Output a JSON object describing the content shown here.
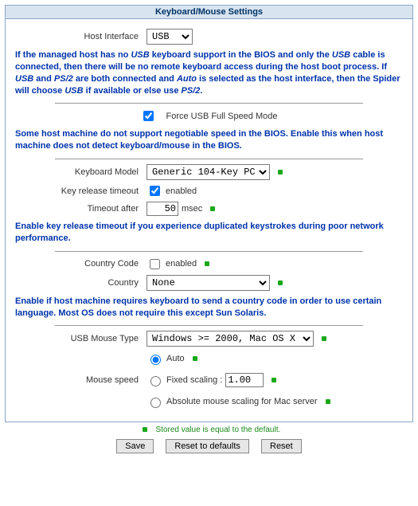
{
  "title": "Keyboard/Mouse Settings",
  "host_interface": {
    "label": "Host Interface",
    "value": "USB",
    "options": [
      "USB"
    ]
  },
  "help_host": "If the managed host has no <i>USB</i> keyboard support in the BIOS and only the <i>USB</i> cable is connected, then there will be no remote keyboard access during the host boot process. If <i>USB</i> and <i>PS/2</i> are both connected and <i>Auto</i> is selected as the host interface, then the Spider will choose <i>USB</i> if available or else use <i>PS/2</i>.",
  "force_usb": {
    "label": "Force USB Full Speed Mode",
    "checked": true
  },
  "help_usb_speed": "Some host machine do not support negotiable speed in the BIOS. Enable this when host machine does not detect keyboard/mouse in the BIOS.",
  "keyboard_model": {
    "label": "Keyboard Model",
    "value": "Generic 104-Key PC",
    "options": [
      "Generic 104-Key PC"
    ]
  },
  "key_release": {
    "label": "Key release timeout",
    "enabled_label": "enabled",
    "checked": true
  },
  "timeout": {
    "label": "Timeout after",
    "value": "50",
    "unit": "msec"
  },
  "help_release": "Enable key release timeout if you experience duplicated keystrokes during poor network performance.",
  "country_code": {
    "label": "Country Code",
    "enabled_label": "enabled",
    "checked": false
  },
  "country": {
    "label": "Country",
    "value": "None",
    "options": [
      "None"
    ]
  },
  "help_country": "Enable if host machine requires keyboard to send a country code in order to use certain language. Most OS does not require this except Sun Solaris.",
  "mouse_type": {
    "label": "USB Mouse Type",
    "value": "Windows >= 2000, Mac OS X",
    "options": [
      "Windows >= 2000, Mac OS X"
    ]
  },
  "mouse_speed": {
    "label": "Mouse speed",
    "auto_label": "Auto",
    "fixed_label": "Fixed scaling :",
    "fixed_value": "1.00",
    "abs_label": "Absolute mouse scaling for Mac server",
    "selected": "auto"
  },
  "legend": "Stored value is equal to the default.",
  "buttons": {
    "save": "Save",
    "reset_defaults": "Reset to defaults",
    "reset": "Reset"
  }
}
